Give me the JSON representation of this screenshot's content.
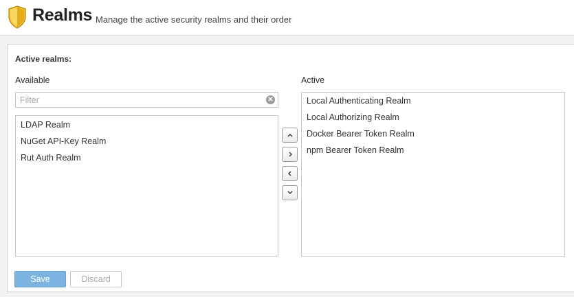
{
  "header": {
    "title": "Realms",
    "subtitle": "Manage the active security realms and their order",
    "icon": "shield-icon"
  },
  "section_title": "Active realms:",
  "available": {
    "label": "Available",
    "filter_placeholder": "Filter",
    "items": [
      "LDAP Realm",
      "NuGet API-Key Realm",
      "Rut Auth Realm"
    ]
  },
  "active": {
    "label": "Active",
    "items": [
      "Local Authenticating Realm",
      "Local Authorizing Realm",
      "Docker Bearer Token Realm",
      "npm Bearer Token Realm"
    ]
  },
  "move_buttons": [
    "move-up-icon",
    "move-right-icon",
    "move-left-icon",
    "move-down-icon"
  ],
  "buttons": {
    "save": "Save",
    "discard": "Discard"
  },
  "colors": {
    "accent": "#7cb4df",
    "shield": "#f2c230"
  }
}
